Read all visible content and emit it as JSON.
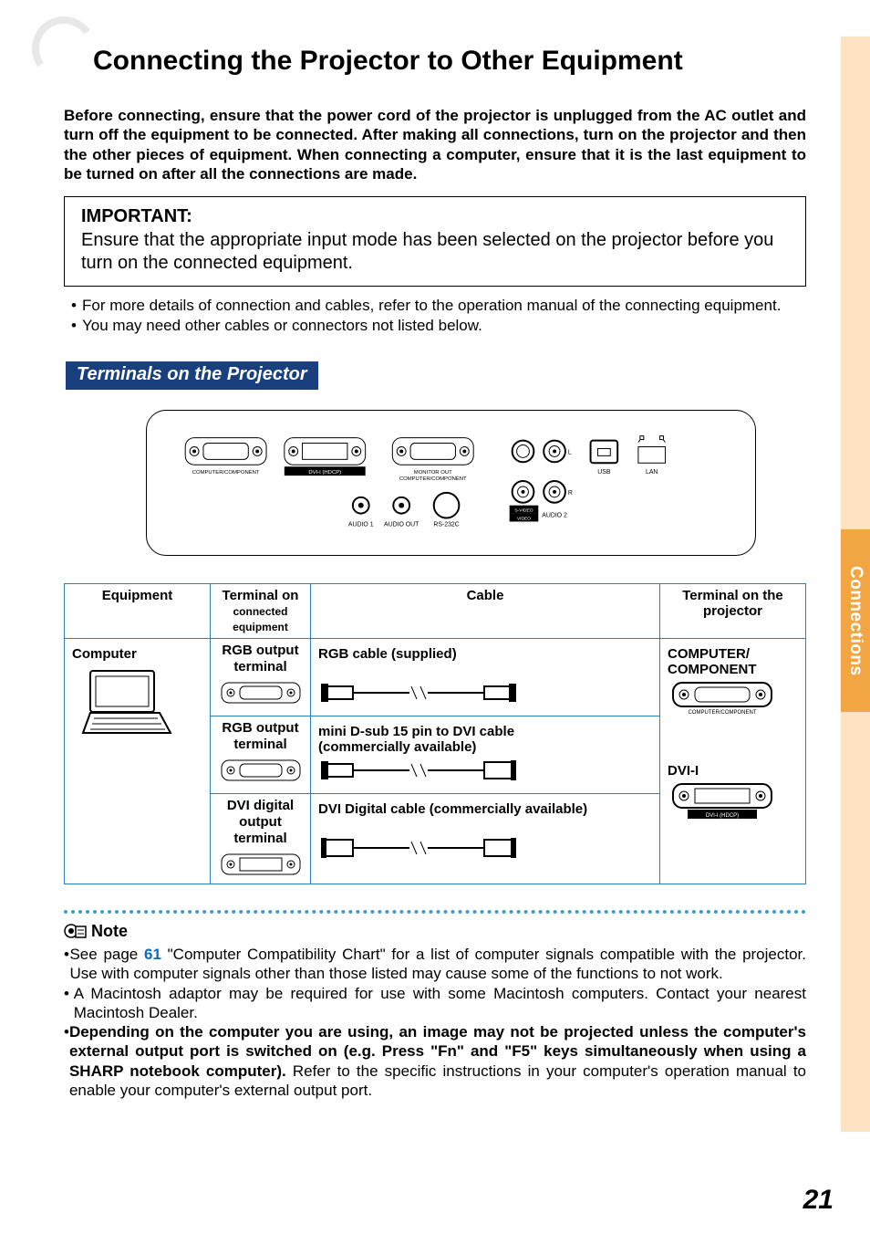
{
  "page_number": "21",
  "side_tab": "Connections",
  "title": "Connecting the Projector to Other Equipment",
  "intro": "Before connecting, ensure that the power cord of the projector is unplugged from the AC outlet and turn off the equipment to be connected. After making all connections, turn on the projector and then the other pieces of equipment. When connecting a computer, ensure that it is the last equipment to be turned on after all the connections are made.",
  "important": {
    "heading": "IMPORTANT:",
    "body": "Ensure that the appropriate input mode has been selected on the projector before you turn on the connected equipment."
  },
  "bullets": [
    "For more details of connection and cables, refer to the operation manual of the connecting equipment.",
    "You may need other cables or connectors not listed below."
  ],
  "section_heading": "Terminals on the Projector",
  "panel_labels": {
    "comp": "COMPUTER/COMPONENT",
    "dvi": "DVI-I (HDCP)",
    "monitor1": "MONITOR OUT",
    "monitor2": "COMPUTER/COMPONENT",
    "audio1": "AUDIO 1",
    "audioout": "AUDIO OUT",
    "rs232c": "RS-232C",
    "usb": "USB",
    "lan": "LAN",
    "svideo": "S-VIDEO",
    "video": "VIDEO",
    "audio2": "AUDIO 2",
    "l": "L",
    "r": "R"
  },
  "table": {
    "headers": {
      "equipment": "Equipment",
      "t1a": "Terminal on",
      "t1b": "connected equipment",
      "cable": "Cable",
      "t2a": "Terminal on the",
      "t2b": "projector"
    },
    "row_equipment": "Computer",
    "r1": {
      "term": "RGB output terminal",
      "cable": "RGB cable (supplied)",
      "proj": "COMPUTER/ COMPONENT",
      "proj_sub": "COMPUTER/COMPONENT"
    },
    "r2": {
      "term": "RGB output terminal",
      "cable1": "mini D-sub 15 pin to DVI cable",
      "cable2": "(commercially available)",
      "proj": "DVI-I",
      "proj_sub": "DVI-I (HDCP)"
    },
    "r3": {
      "term": "DVI digital output terminal",
      "cable": "DVI Digital cable (commercially available)"
    }
  },
  "note": {
    "heading": "Note",
    "n1a": "See page ",
    "n1_page": "61",
    "n1b": " \"Computer Compatibility Chart\" for a list of computer signals compatible with the projector. Use with computer signals other than those listed may cause some of the functions to not work.",
    "n2": "A Macintosh adaptor may be required for use with some Macintosh computers. Contact your nearest Macintosh Dealer.",
    "n3_bold": "Depending on the computer you are using, an image may not be projected unless the computer's external output port is switched on (e.g. Press \"Fn\" and \"F5\" keys simultaneously when using a SHARP notebook computer).",
    "n3_rest": " Refer to the specific instructions in your computer's operation manual to enable your computer's external output port."
  }
}
